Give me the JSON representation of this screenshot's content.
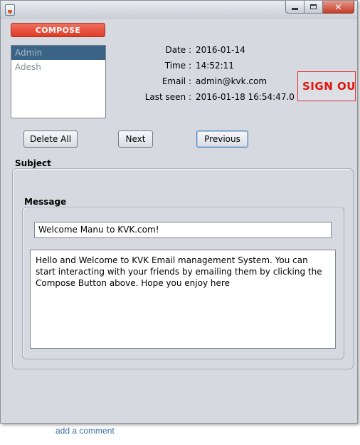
{
  "window": {
    "controls": {
      "minimize_icon": "minimize-icon",
      "maximize_icon": "maximize-icon",
      "close_icon": "close-icon",
      "close_glyph": "✕"
    }
  },
  "compose": {
    "label": "COMPOSE"
  },
  "users": [
    {
      "name": "Admin",
      "selected": true
    },
    {
      "name": "Adesh",
      "selected": false
    }
  ],
  "info": {
    "date_label": "Date :",
    "date_value": "2016-01-14",
    "time_label": "Time :",
    "time_value": "14:52:11",
    "email_label": "Email :",
    "email_value": "admin@kvk.com",
    "last_seen_label": "Last seen :",
    "last_seen_value": "2016-01-18 16:54:47.0"
  },
  "signout": {
    "label": "SIGN OUT",
    "color": "#e0150d"
  },
  "actions": {
    "delete_all": "Delete All",
    "next": "Next",
    "previous": "Previous"
  },
  "subject": {
    "label": "Subject",
    "value": "Welcome Manu to KVK.com!"
  },
  "message": {
    "label": "Message",
    "body": "Hello and Welcome to KVK Email management System. You can start interacting with your friends by emailing them by clicking the Compose Button above. Hope you enjoy here"
  },
  "footer": {
    "add_comment": "add a comment"
  },
  "colors": {
    "accent": "#e03b25",
    "selection": "#3a6385",
    "link": "#3b6fa8",
    "window_bg": "#d6d9df"
  }
}
